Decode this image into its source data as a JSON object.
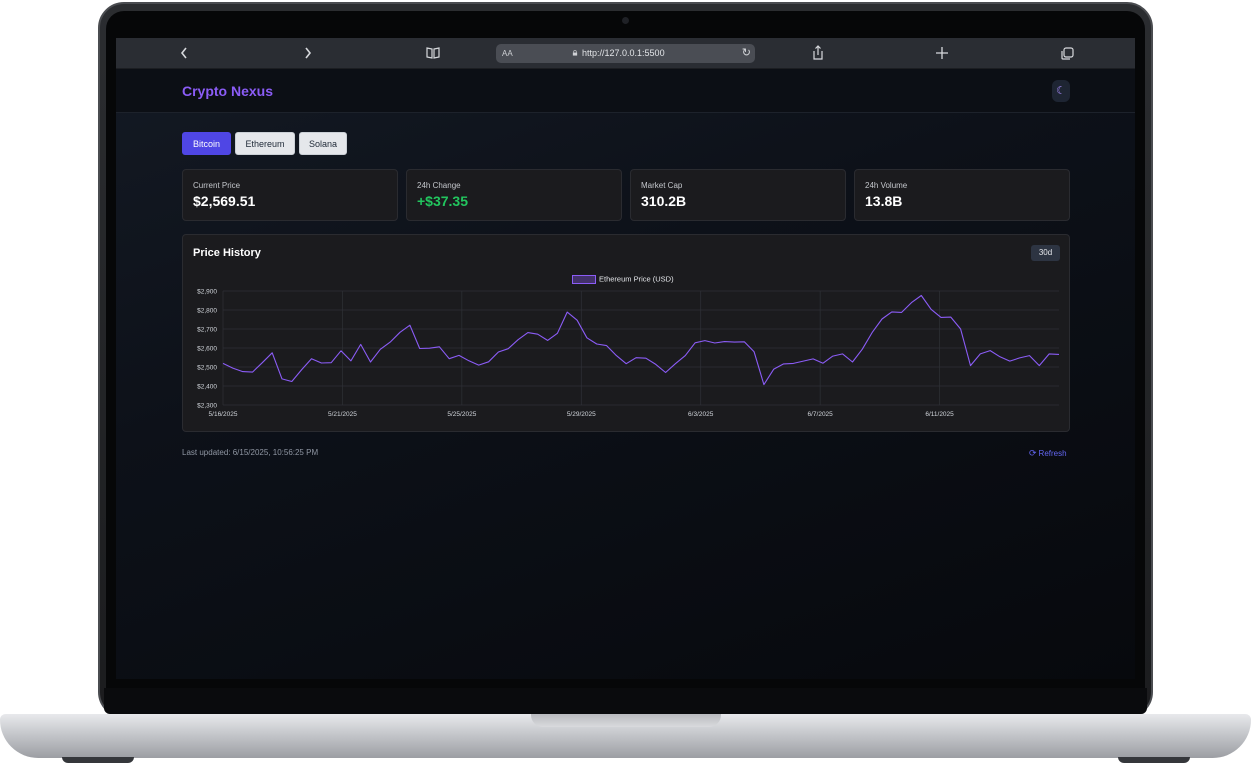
{
  "browser": {
    "url": "http://127.0.0.1:5500",
    "aa_label": "AA",
    "icons": [
      "chevron-left-icon",
      "chevron-right-icon",
      "book-icon",
      "lock-icon",
      "reload-icon",
      "share-icon",
      "plus-icon",
      "tabs-icon"
    ]
  },
  "app": {
    "brand": "Crypto Nexus",
    "theme_icon": "moon-icon",
    "accent_color": "#8b5cf6",
    "active_tab_color": "#4f46e5"
  },
  "coins": [
    {
      "label": "Bitcoin",
      "active": true
    },
    {
      "label": "Ethereum",
      "active": false
    },
    {
      "label": "Solana",
      "active": false
    }
  ],
  "stats": [
    {
      "label": "Current Price",
      "value": "$2,569.51"
    },
    {
      "label": "24h Change",
      "value": "+$37.35",
      "color": "#22c55e"
    },
    {
      "label": "Market Cap",
      "value": "310.2B"
    },
    {
      "label": "24h Volume",
      "value": "13.8B"
    }
  ],
  "chart_panel": {
    "title": "Price History",
    "range_label": "30d",
    "legend_label": "Ethereum Price (USD)"
  },
  "chart_data": {
    "type": "line",
    "title": "",
    "xlabel": "",
    "ylabel": "",
    "ylim": [
      2300,
      2900
    ],
    "y_ticks": [
      "$2,300",
      "$2,400",
      "$2,500",
      "$2,600",
      "$2,700",
      "$2,800",
      "$2,900"
    ],
    "y_tick_values": [
      2300,
      2400,
      2500,
      2600,
      2700,
      2800,
      2900
    ],
    "x_ticks": [
      "5/16/2025",
      "5/21/2025",
      "5/25/2025",
      "5/29/2025",
      "6/3/2025",
      "6/7/2025",
      "6/11/2025"
    ],
    "grid": true,
    "legend_position": "top-center",
    "series": [
      {
        "name": "Ethereum Price (USD)",
        "color": "#8b5cf6",
        "values": [
          2500,
          2488,
          2482,
          2492,
          2510,
          2575,
          2450,
          2405,
          2480,
          2550,
          2540,
          2510,
          2585,
          2545,
          2600,
          2520,
          2600,
          2650,
          2670,
          2720,
          2610,
          2580,
          2600,
          2550,
          2580,
          2520,
          2510,
          2540,
          2560,
          2590,
          2650,
          2700,
          2660,
          2640,
          2690,
          2770,
          2740,
          2660,
          2640,
          2600,
          2560,
          2530,
          2530,
          2540,
          2520,
          2490,
          2505,
          2560,
          2640,
          2620,
          2620,
          2640,
          2650,
          2620,
          2580,
          2420,
          2470,
          2510,
          2525,
          2550,
          2530,
          2520,
          2570,
          2550,
          2520,
          2600,
          2700,
          2740,
          2790,
          2800,
          2820,
          2870,
          2810,
          2780,
          2750,
          2700,
          2520,
          2550,
          2580,
          2560,
          2550,
          2535,
          2560,
          2520,
          2550,
          2560
        ]
      }
    ]
  },
  "footer": {
    "last_updated": "Last updated: 6/15/2025, 10:56:25 PM",
    "refresh_label": "Refresh",
    "refresh_icon": "refresh-icon"
  }
}
